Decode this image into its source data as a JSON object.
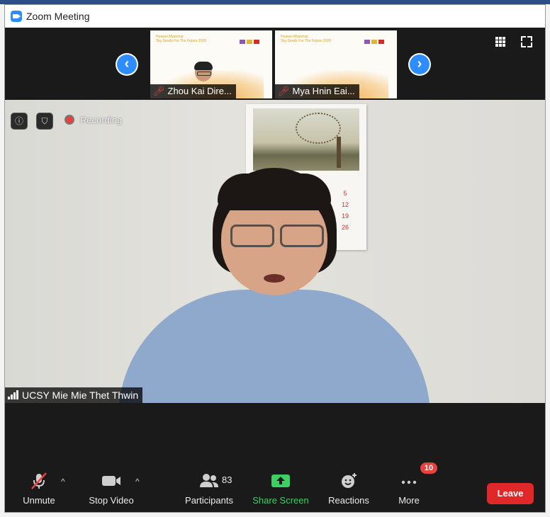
{
  "window": {
    "title": "Zoom Meeting"
  },
  "gallery": {
    "prev_icon": "chevron-left-icon",
    "next_icon": "chevron-right-icon",
    "thumbnails": [
      {
        "name": "Zhou Kai Dire...",
        "muted": true,
        "slide_title": "Huawei Myanmar",
        "slide_subtitle": "Sky Seeds For The Future 2020"
      },
      {
        "name": "Mya Hnin Eai...",
        "muted": true,
        "slide_title": "Huawei Myanmar",
        "slide_subtitle": "Sky Seeds For The Future 2020"
      }
    ],
    "view_icon": "grid-view-icon",
    "fullscreen_icon": "fullscreen-icon"
  },
  "main_video": {
    "speaker": "UCSY Mie Mie Thet Thwin",
    "recording_label": "Recording",
    "info_icon": "info-icon",
    "security_icon": "shield-icon"
  },
  "toolbar": {
    "unmute": "Unmute",
    "stop_video": "Stop Video",
    "participants": "Participants",
    "participants_count": "83",
    "share_screen": "Share Screen",
    "reactions": "Reactions",
    "more": "More",
    "more_badge": "10",
    "leave": "Leave"
  },
  "colors": {
    "accent_blue": "#2d8cff",
    "share_green": "#3ccf61",
    "leave_red": "#e02828",
    "badge_red": "#e8423f"
  }
}
